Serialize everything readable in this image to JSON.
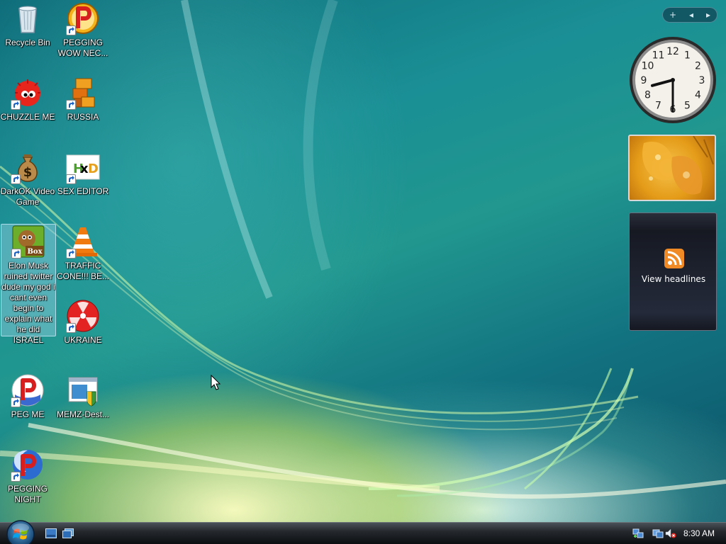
{
  "desktop": {
    "icons": [
      {
        "id": "recycle-bin",
        "label": "Recycle Bin",
        "icon": "recycle-bin-icon",
        "shortcut": false
      },
      {
        "id": "pegging-wow",
        "label": "PEGGING WOW NEC...",
        "icon": "peggle-p-icon",
        "shortcut": true
      },
      {
        "id": "chuzzle",
        "label": "CHUZZLE ME",
        "icon": "chuzzle-icon",
        "shortcut": true
      },
      {
        "id": "russia",
        "label": "RUSSIA",
        "icon": "game-blocks-icon",
        "shortcut": true
      },
      {
        "id": "darkok",
        "label": "DarkOK Video Game",
        "icon": "money-bag-icon",
        "shortcut": true
      },
      {
        "id": "sex-editor",
        "label": "SEX EDITOR",
        "icon": "hxd-editor-icon",
        "shortcut": true
      },
      {
        "id": "elon-musk",
        "label": "Elon Musk ruined twitter dude my god i cant even begin to explain what he did ISRAEL",
        "icon": "zuma-box-icon",
        "shortcut": true,
        "selected": true
      },
      {
        "id": "traffic-cone",
        "label": "TRAFFIC CONE!!! BE...",
        "icon": "vlc-cone-icon",
        "shortcut": true
      },
      {
        "id": "ukraine",
        "label": "UKRAINE",
        "icon": "radiation-icon",
        "shortcut": true
      },
      {
        "id": "peg-me",
        "label": "PEG ME",
        "icon": "peggle-p-icon",
        "shortcut": true
      },
      {
        "id": "memz",
        "label": "MEMZ-Dest...",
        "icon": "memz-window-icon",
        "shortcut": false
      },
      {
        "id": "pegging-night",
        "label": "PEGGING NIGHT",
        "icon": "peggle-nights-icon",
        "shortcut": true
      }
    ]
  },
  "sidebar": {
    "controls": {
      "add": "+",
      "prev": "◂",
      "next": "▸"
    },
    "clock": {
      "hour": 8,
      "minute": 30,
      "numerals": [
        "12",
        "1",
        "2",
        "3",
        "4",
        "5",
        "6",
        "7",
        "8",
        "9",
        "10",
        "11"
      ]
    },
    "slideshow": {
      "icon": "leaf-photo"
    },
    "feed": {
      "label": "View headlines",
      "icon": "rss-icon"
    }
  },
  "taskbar": {
    "start_icon": "windows-orb-icon",
    "quick_launch": [
      "show-desktop-icon",
      "switch-windows-icon"
    ],
    "tray": {
      "time": "8:30 AM",
      "icons": [
        "network-icon",
        "wireless-icon",
        "volume-muted-icon"
      ]
    }
  }
}
